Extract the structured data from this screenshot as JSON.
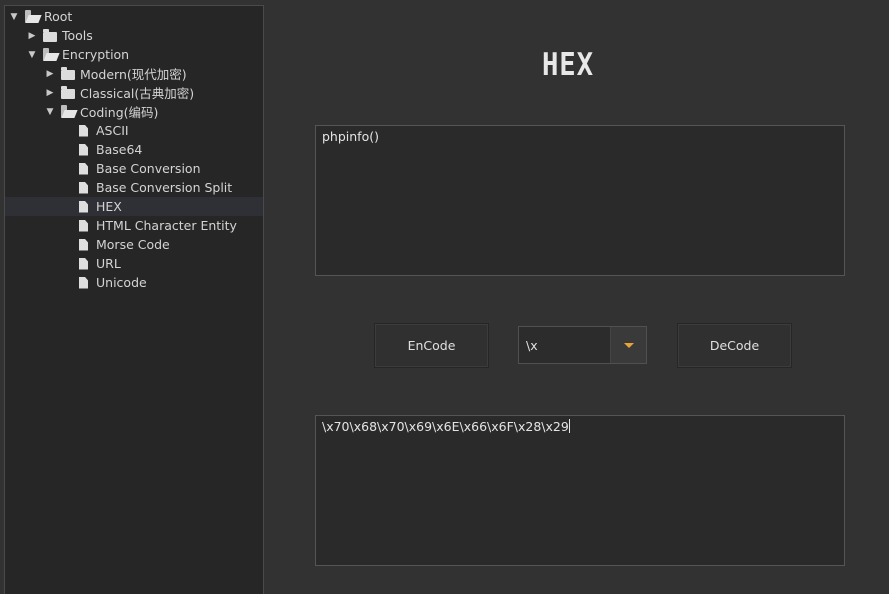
{
  "tree": [
    {
      "label": "Root",
      "expanded": true,
      "icon": "folder-open-icon",
      "depth": 0
    },
    {
      "label": "Tools",
      "expanded": false,
      "icon": "folder-icon",
      "depth": 1
    },
    {
      "label": "Encryption",
      "expanded": true,
      "icon": "folder-open-icon",
      "depth": 1
    },
    {
      "label": "Modern(现代加密)",
      "expanded": false,
      "icon": "folder-icon",
      "depth": 2
    },
    {
      "label": "Classical(古典加密)",
      "expanded": false,
      "icon": "folder-icon",
      "depth": 2
    },
    {
      "label": "Coding(编码)",
      "expanded": true,
      "icon": "folder-open-icon",
      "depth": 2
    },
    {
      "label": "ASCII",
      "icon": "file-icon",
      "depth": 3
    },
    {
      "label": "Base64",
      "icon": "file-icon",
      "depth": 3
    },
    {
      "label": "Base Conversion",
      "icon": "file-icon",
      "depth": 3
    },
    {
      "label": "Base Conversion Split",
      "icon": "file-icon",
      "depth": 3
    },
    {
      "label": "HEX",
      "icon": "file-icon",
      "depth": 3,
      "selected": true
    },
    {
      "label": "HTML Character Entity",
      "icon": "file-icon",
      "depth": 3
    },
    {
      "label": "Morse Code",
      "icon": "file-icon",
      "depth": 3
    },
    {
      "label": "URL",
      "icon": "file-icon",
      "depth": 3
    },
    {
      "label": "Unicode",
      "icon": "file-icon",
      "depth": 3
    }
  ],
  "main": {
    "logo_text": "HEX",
    "input_text": "phpinfo()",
    "encode_label": "EnCode",
    "decode_label": "DeCode",
    "separator_selected": "\\x",
    "output_text": "\\x70\\x68\\x70\\x69\\x6E\\x66\\x6F\\x28\\x29"
  },
  "colors": {
    "background": "#323232",
    "sidebar_bg": "#262626",
    "dropdown_arrow": "#e8a33a",
    "selected_row": "#2f2f36"
  }
}
